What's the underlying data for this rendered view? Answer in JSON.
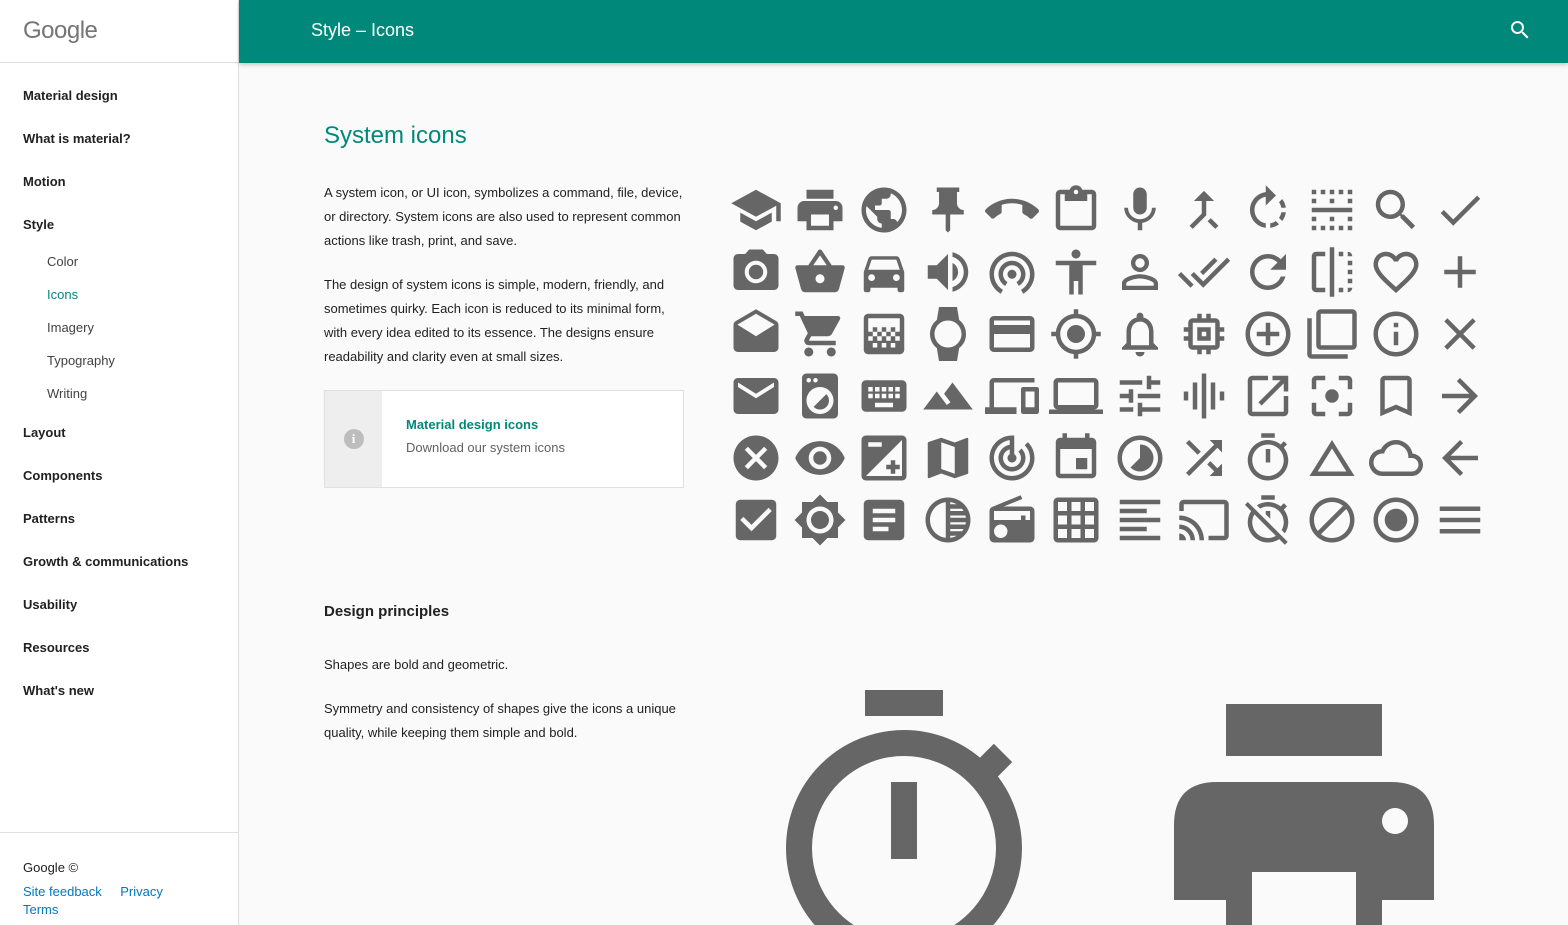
{
  "logo": "Google",
  "header": {
    "title": "Style  –  Icons"
  },
  "nav": {
    "items": [
      {
        "label": "Material design"
      },
      {
        "label": "What is material?"
      },
      {
        "label": "Motion"
      },
      {
        "label": "Style"
      }
    ],
    "style_sub": [
      {
        "label": "Color"
      },
      {
        "label": "Icons",
        "active": true
      },
      {
        "label": "Imagery"
      },
      {
        "label": "Typography"
      },
      {
        "label": "Writing"
      }
    ],
    "items_after": [
      {
        "label": "Layout"
      },
      {
        "label": "Components"
      },
      {
        "label": "Patterns"
      },
      {
        "label": "Growth & communications"
      },
      {
        "label": "Usability"
      },
      {
        "label": "Resources"
      },
      {
        "label": "What's new"
      }
    ]
  },
  "footer": {
    "copyright": "Google ©",
    "links": [
      "Site feedback",
      "Privacy",
      "Terms"
    ]
  },
  "main": {
    "title": "System icons",
    "para1": "A system icon, or UI icon, symbolizes a command, file, device, or directory. System icons are also used to represent common actions like trash, print, and save.",
    "para2": "The design of system icons is simple, modern, friendly, and sometimes quirky. Each icon is reduced to its minimal form, with every idea edited to its essence. The designs ensure readability and clarity even at small sizes.",
    "card": {
      "title": "Material design icons",
      "subtitle": "Download our system icons",
      "icon": "info-icon"
    },
    "section_title": "Design principles",
    "para3": "Shapes are bold and geometric.",
    "para4": "Symmetry and consistency of shapes give the icons a unique quality, while keeping them simple and bold."
  },
  "icon_grid": [
    [
      "school",
      "print",
      "public",
      "push-pin",
      "call-end",
      "assignment",
      "mic",
      "call-merge",
      "rotate-right",
      "border-horizontal",
      "search",
      "check"
    ],
    [
      "camera",
      "shopping-basket",
      "car",
      "volume-up",
      "wifi-tethering",
      "accessibility",
      "person-outline",
      "done-all",
      "refresh",
      "flip",
      "favorite-border",
      "add"
    ],
    [
      "drafts",
      "shopping-cart",
      "gradient",
      "watch",
      "credit-card",
      "gps-fixed",
      "notifications-none",
      "memory",
      "add-circle-outline",
      "filter-none",
      "info-outline",
      "close"
    ],
    [
      "email",
      "local-laundry",
      "keyboard",
      "landscape",
      "devices",
      "laptop",
      "tune",
      "graphic-eq",
      "open-in-new",
      "center-focus",
      "bookmark-border",
      "arrow-forward"
    ],
    [
      "cancel",
      "visibility",
      "exposure",
      "map",
      "track-changes",
      "event",
      "timelapse",
      "shuffle",
      "timer",
      "change-history",
      "cloud-queue",
      "arrow-back"
    ],
    [
      "check-box",
      "brightness",
      "subject",
      "tonality",
      "radio",
      "grid-on",
      "format-align-left",
      "cast",
      "timer-off",
      "block",
      "radio-button-checked",
      "menu"
    ]
  ],
  "colors": {
    "accent": "#00897b",
    "icon": "#666666",
    "link": "#0277bd"
  }
}
